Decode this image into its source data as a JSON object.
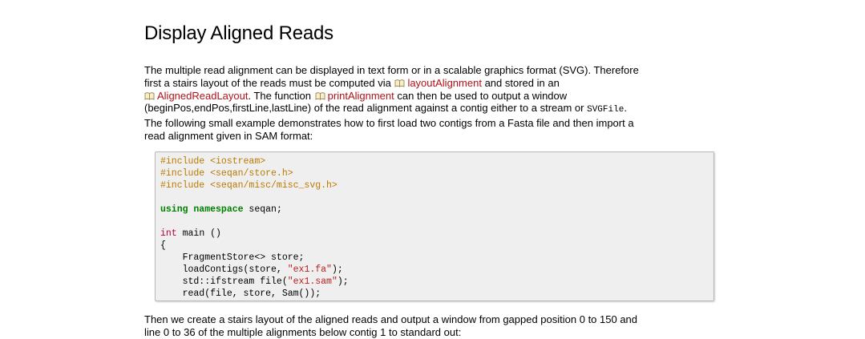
{
  "title": "Display Aligned Reads",
  "paragraph1": {
    "l1": "The multiple read alignment can be displayed in text form or in a scalable graphics format (SVG). Therefore",
    "l2_before": "first a stairs layout of the reads must be computed via",
    "l2_link": "layoutAlignment",
    "l2_after": "and stored in an",
    "l3_link1": "AlignedReadLayout",
    "l3_mid": ". The function",
    "l3_link2": "printAlignment",
    "l3_after": "can then be used to output a window",
    "l4_before": "(beginPos,endPos,firstLine,lastLine) of the read alignment against a contig either to a stream or",
    "l4_code": "SVGFile",
    "l4_after": ".",
    "l5": "The following small example demonstrates how to first load two contigs from a Fasta file and then import a",
    "l6": "read alignment given in SAM format:"
  },
  "code": {
    "include1": "#include <iostream>",
    "include2": "#include <seqan/store.h>",
    "include3": "#include <seqan/misc/misc_svg.h>",
    "using_kw": "using namespace",
    "using_rest": " seqan;",
    "int_kw": "int",
    "main_rest": " main ()",
    "brace": "{",
    "line_store": "    FragmentStore<> store;",
    "line_load_a": "    loadContigs(store, ",
    "line_load_str": "\"ex1.fa\"",
    "line_load_b": ");",
    "line_ifs_a": "    std::ifstream file(",
    "line_ifs_str": "\"ex1.sam\"",
    "line_ifs_b": ");",
    "line_read": "    read(file, store, Sam());"
  },
  "paragraph2": {
    "l1": "Then we create a stairs layout of the aligned reads and output a window from gapped position 0 to 150 and",
    "l2": "line 0 to 36 of the multiple alignments below contig 1 to standard out:"
  },
  "icons": {
    "function_link_icon": "book-icon"
  },
  "colors": {
    "link": "#b0121a",
    "preprocessor": "#bc7a00",
    "keyword": "#008000",
    "string": "#ba2121",
    "code_bg": "#efefef"
  }
}
